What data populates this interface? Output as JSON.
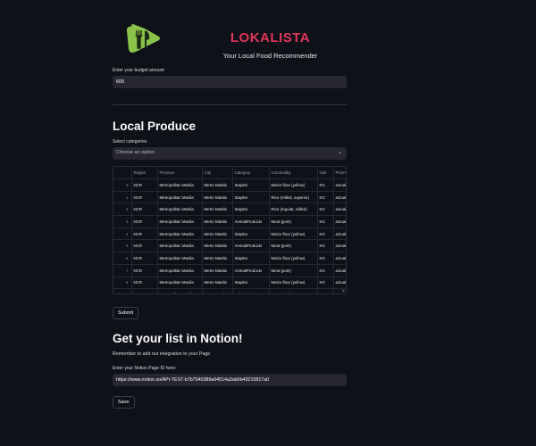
{
  "header": {
    "title": "LOKALISTA",
    "subtitle": "Your Local Food Recommender"
  },
  "budget": {
    "label": "Enter your budget amount",
    "value": "600"
  },
  "produce": {
    "heading": "Local Produce",
    "select_label": "Select categories",
    "select_placeholder": "Choose an option",
    "columns": [
      "",
      "Region",
      "Province",
      "City",
      "Category",
      "Commodity",
      "Unit",
      "PriceT"
    ],
    "rows": [
      [
        "0",
        "NCR",
        "Metropolitan Manila",
        "Metro Manila",
        "Staples",
        "Maize flour (yellow)",
        "KG",
        "actual"
      ],
      [
        "1",
        "NCR",
        "Metropolitan Manila",
        "Metro Manila",
        "Staples",
        "Rice (milled, superior)",
        "KG",
        "actual"
      ],
      [
        "2",
        "NCR",
        "Metropolitan Manila",
        "Metro Manila",
        "Staples",
        "Rice (regular, milled)",
        "KG",
        "actual"
      ],
      [
        "3",
        "NCR",
        "Metropolitan Manila",
        "Metro Manila",
        "AnimalProducts",
        "Meat (pork)",
        "KG",
        "actual"
      ],
      [
        "4",
        "NCR",
        "Metropolitan Manila",
        "Metro Manila",
        "Staples",
        "Maize flour (yellow)",
        "KG",
        "actual"
      ],
      [
        "5",
        "NCR",
        "Metropolitan Manila",
        "Metro Manila",
        "AnimalProducts",
        "Meat (pork)",
        "KG",
        "actual"
      ],
      [
        "6",
        "NCR",
        "Metropolitan Manila",
        "Metro Manila",
        "Staples",
        "Maize flour (yellow)",
        "KG",
        "actual"
      ],
      [
        "7",
        "NCR",
        "Metropolitan Manila",
        "Metro Manila",
        "AnimalProducts",
        "Meat (pork)",
        "KG",
        "actual"
      ],
      [
        "8",
        "NCR",
        "Metropolitan Manila",
        "Metro Manila",
        "Staples",
        "Maize flour (yellow)",
        "KG",
        "actual"
      ],
      [
        "9",
        "NCR",
        "Metropolitan Manila",
        "Metro Manila",
        "AnimalProducts",
        "Meat (pork)",
        "KG",
        "actual"
      ]
    ],
    "submit_label": "Submit"
  },
  "notion": {
    "heading": "Get your list in Notion!",
    "note": "Remember to add our integration to your Page",
    "page_id_label": "Enter your Notion Page ID here:",
    "page_id_value": "https://www.notion.so/API-TEST-b7b7540389a64514a3ab6b49215817a0",
    "save_label": "Save"
  },
  "colors": {
    "background": "#0e1117",
    "accent": "#e0365d",
    "input_bg": "#262730",
    "logo_green": "#8bc34a"
  },
  "icons": {
    "logo": "fork-knife-logo-icon",
    "select_chevron": "chevron-down-icon",
    "resize": "resize-handle-icon"
  }
}
